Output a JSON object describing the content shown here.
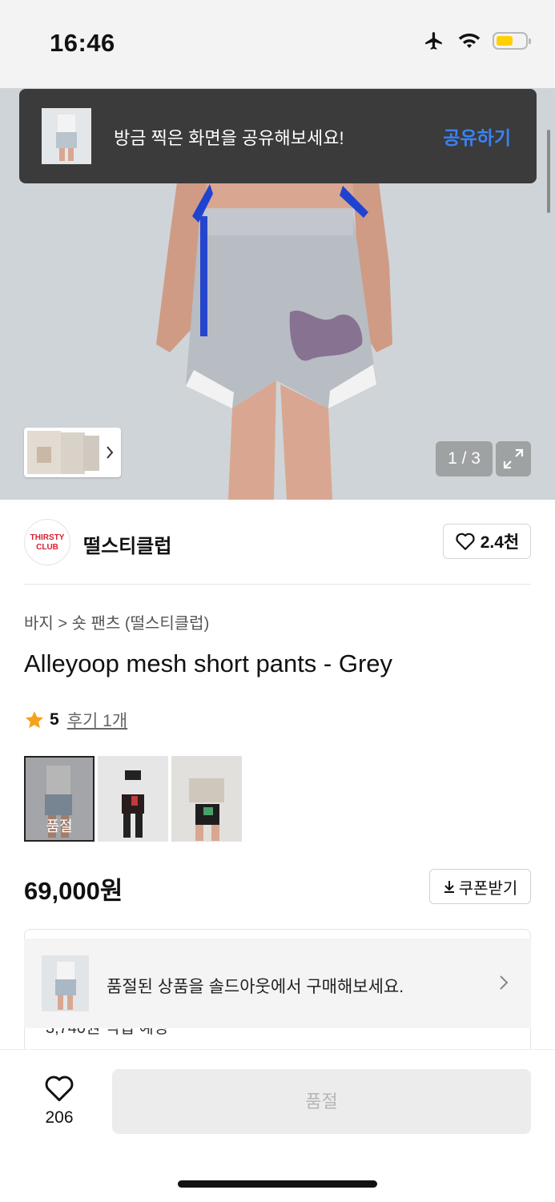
{
  "status_bar": {
    "time": "16:46",
    "icons": [
      "airplane-icon",
      "wifi-icon",
      "battery-icon"
    ]
  },
  "toast": {
    "message": "방금 찍은 화면을 공유해보세요!",
    "action": "공유하기"
  },
  "gallery": {
    "page_indicator": "1 / 3"
  },
  "brand": {
    "logo_line1": "THIRSTY",
    "logo_line2": "CLUB",
    "name": "떨스티클럽",
    "likes": "2.4천"
  },
  "product": {
    "breadcrumb": "바지 > 숏 팬츠 (떨스티클럽)",
    "title": "Alleyoop mesh short pants - Grey",
    "rating": "5",
    "review_link": "후기 1개",
    "variant_soldout_label": "품절",
    "price": "69,000원",
    "coupon_label": "쿠폰받기"
  },
  "info_box": {
    "peek_text": "3,740원 적립 예정"
  },
  "soldout_banner": {
    "text": "품절된 상품을 솔드아웃에서 구매해보세요."
  },
  "bottom_bar": {
    "wish_count": "206",
    "buy_label": "품절"
  },
  "colors": {
    "accent_link": "#3b82f6",
    "brand_red": "#d92030",
    "star": "#f7a21b"
  }
}
